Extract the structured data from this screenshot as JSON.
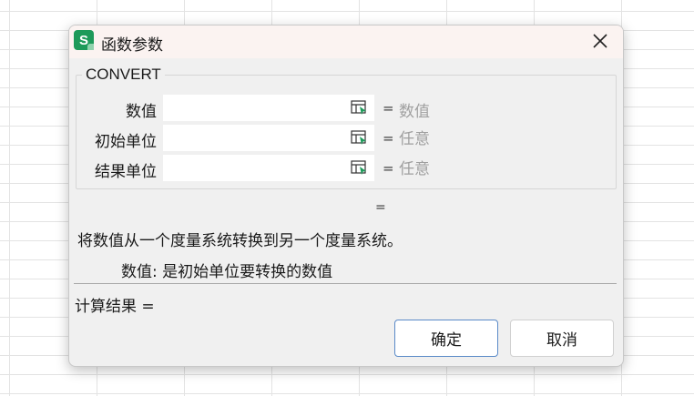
{
  "dialog": {
    "app_icon_letter": "S",
    "title": "函数参数",
    "function_name": "CONVERT"
  },
  "arguments": [
    {
      "label": "数值",
      "value_hint": "数值"
    },
    {
      "label": "初始单位",
      "value_hint": "任意"
    },
    {
      "label": "结果单位",
      "value_hint": "任意"
    }
  ],
  "equals_sign": "=",
  "result_equals": "=",
  "description": "将数值从一个度量系统转换到另一个度量系统。",
  "param_description": "数值:  是初始单位要转换的数值",
  "calc_result": "计算结果 =",
  "buttons": {
    "ok": "确定",
    "cancel": "取消"
  },
  "colors": {
    "app_icon": "#1d9a5a",
    "primary_border": "#5a8ac8",
    "ref_icon_arrow": "#1d9a5a"
  }
}
